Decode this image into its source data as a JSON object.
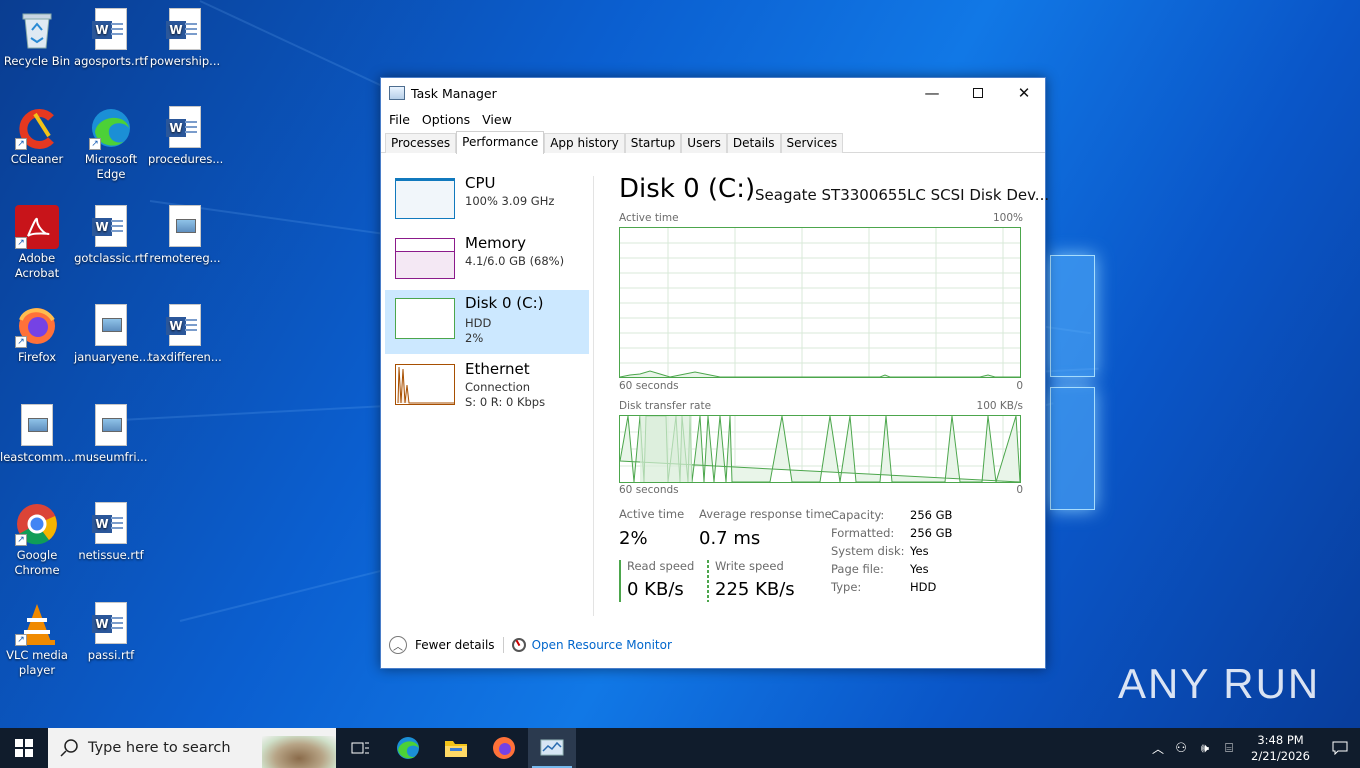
{
  "desktop": {
    "icons": [
      {
        "label": "Recycle Bin",
        "icon": "recycle-bin-icon"
      },
      {
        "label": "agosports.rtf",
        "icon": "word-doc-icon"
      },
      {
        "label": "powership...",
        "icon": "word-doc-icon"
      },
      {
        "label": "CCleaner",
        "icon": "ccleaner-icon"
      },
      {
        "label": "Microsoft Edge",
        "icon": "edge-icon"
      },
      {
        "label": "procedures...",
        "icon": "word-doc-icon"
      },
      {
        "label": "Adobe Acrobat",
        "icon": "acrobat-icon"
      },
      {
        "label": "gotclassic.rtf",
        "icon": "word-doc-icon"
      },
      {
        "label": "remotereg...",
        "icon": "image-doc-icon"
      },
      {
        "label": "Firefox",
        "icon": "firefox-icon"
      },
      {
        "label": "januaryene...",
        "icon": "image-doc-icon"
      },
      {
        "label": "taxdifferen...",
        "icon": "word-doc-icon"
      },
      {
        "label": "leastcomm...",
        "icon": "image-doc-icon"
      },
      {
        "label": "museumfri...",
        "icon": "image-doc-icon"
      },
      {
        "label": "Google Chrome",
        "icon": "chrome-icon"
      },
      {
        "label": "netissue.rtf",
        "icon": "word-doc-icon"
      },
      {
        "label": "VLC media player",
        "icon": "vlc-icon"
      },
      {
        "label": "passi.rtf",
        "icon": "word-doc-icon"
      }
    ],
    "watermark": "ANY RUN"
  },
  "window": {
    "title": "Task Manager",
    "menu": [
      "File",
      "Options",
      "View"
    ],
    "tabs": [
      "Processes",
      "Performance",
      "App history",
      "Startup",
      "Users",
      "Details",
      "Services"
    ],
    "active_tab": "Performance"
  },
  "sidebar": {
    "items": [
      {
        "name": "CPU",
        "line1": "100% 3.09 GHz",
        "line2": "",
        "color": "#1179bd"
      },
      {
        "name": "Memory",
        "line1": "4.1/6.0 GB (68%)",
        "line2": "",
        "color": "#8b1a8b"
      },
      {
        "name": "Disk 0 (C:)",
        "line1": "HDD",
        "line2": "2%",
        "color": "#4ca64c"
      },
      {
        "name": "Ethernet",
        "line1": "Connection",
        "line2": "S: 0 R: 0 Kbps",
        "color": "#a74f01"
      }
    ],
    "selected": "Disk 0 (C:)"
  },
  "detail": {
    "title": "Disk 0 (C:)",
    "model": "Seagate ST3300655LC SCSI Disk Dev...",
    "graph1": {
      "label": "Active time",
      "max": "100%",
      "time": "60 seconds",
      "min": "0"
    },
    "graph2": {
      "label": "Disk transfer rate",
      "max": "100 KB/s",
      "time": "60 seconds",
      "min": "0"
    },
    "stats": {
      "active_time_label": "Active time",
      "active_time": "2%",
      "avg_response_label": "Average response time",
      "avg_response": "0.7 ms",
      "read_label": "Read speed",
      "read": "0 KB/s",
      "write_label": "Write speed",
      "write": "225 KB/s"
    },
    "props": [
      {
        "k": "Capacity:",
        "v": "256 GB"
      },
      {
        "k": "Formatted:",
        "v": "256 GB"
      },
      {
        "k": "System disk:",
        "v": "Yes"
      },
      {
        "k": "Page file:",
        "v": "Yes"
      },
      {
        "k": "Type:",
        "v": "HDD"
      }
    ]
  },
  "footer": {
    "fewer_details": "Fewer details",
    "resource_monitor": "Open Resource Monitor"
  },
  "taskbar": {
    "search_placeholder": "Type here to search",
    "time": "3:48 PM",
    "date": "2/21/2026"
  }
}
